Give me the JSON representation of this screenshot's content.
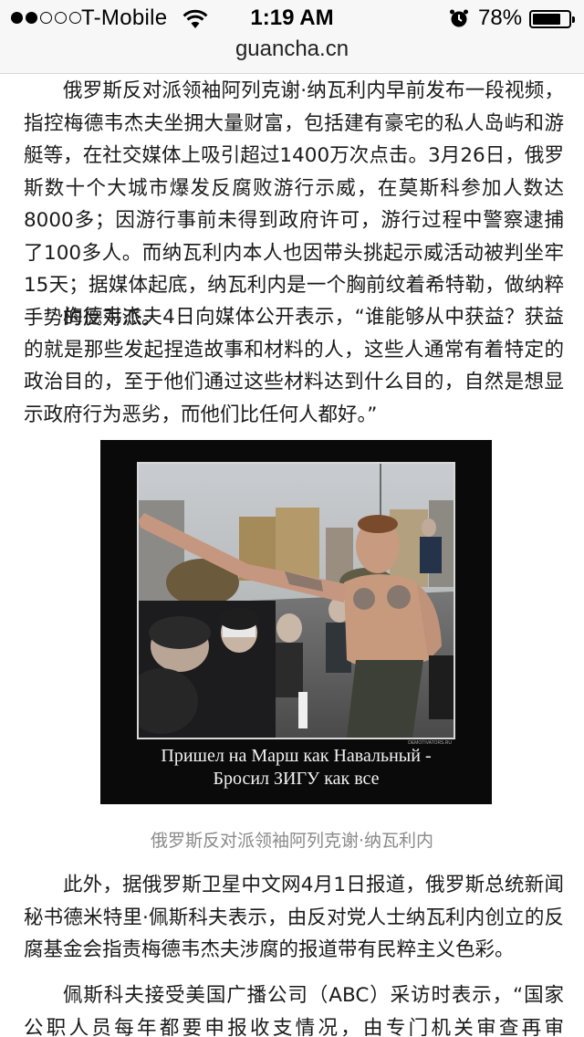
{
  "status_bar": {
    "signal_dots_filled": 2,
    "signal_dots_total": 5,
    "carrier": "T-Mobile",
    "time": "1:19 AM",
    "battery_percent": "78%",
    "battery_level": 0.78
  },
  "browser": {
    "url": "guancha.cn"
  },
  "article": {
    "paragraphs": [
      "俄罗斯反对派领袖阿列克谢·纳瓦利内早前发布一段视频，指控梅德韦杰夫坐拥大量财富，包括建有豪宅的私人岛屿和游艇等，在社交媒体上吸引超过1400万次点击。3月26日，俄罗斯数十个大城市爆发反腐败游行示威，在莫斯科参加人数达8000多；因游行事前未得到政府许可，游行过程中警察逮捕了100多人。而纳瓦利内本人也因带头挑起示威活动被判坐牢15天；据媒体起底，纳瓦利内是一个胸前纹着希特勒，做纳粹手势的反对派。",
      "梅德韦杰夫4日向媒体公开表示，“谁能够从中获益？获益的就是那些发起捏造故事和材料的人，这些人通常有着特定的政治目的，至于他们通过这些材料达到什么目的，自然是想显示政府行为恶劣，而他们比任何人都好。”",
      "此外，据俄罗斯卫星中文网4月1日报道，俄罗斯总统新闻秘书德米特里·佩斯科夫表示，由反对党人士纳瓦利内创立的反腐基金会指责梅德韦杰夫涉腐的报道带有民粹主义色彩。",
      "佩斯科夫接受美国广播公司（ABC）采访时表示，“国家公职人员每年都要申报收支情况，由专门机关审查再审查”，“这就是为什么我"
    ],
    "figure": {
      "image_caption_line1": "Пришел на Марш как Навальный -",
      "image_caption_line2": "Бросил ЗИГУ как все",
      "watermark": "DEMOTIVATORS.RU",
      "caption": "俄罗斯反对派领袖阿列克谢·纳瓦利内"
    }
  },
  "colors": {
    "page_background": "#ffffff",
    "topbar_background": "#f7f7f7",
    "body_text": "#1a1a1a",
    "caption_text": "#8a8a8a",
    "figure_background": "#0a0a0a"
  }
}
